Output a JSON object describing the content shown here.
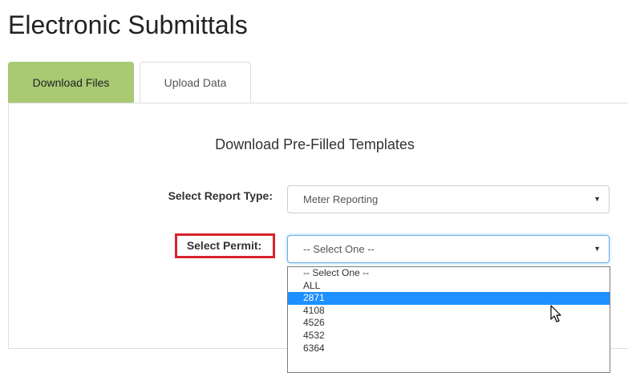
{
  "page": {
    "title": "Electronic Submittals"
  },
  "tabs": [
    {
      "label": "Download Files",
      "active": true
    },
    {
      "label": "Upload Data",
      "active": false
    }
  ],
  "section": {
    "heading": "Download Pre-Filled Templates"
  },
  "form": {
    "report_type": {
      "label": "Select Report Type:",
      "value": "Meter Reporting"
    },
    "permit": {
      "label": "Select Permit:",
      "value": "-- Select One --",
      "options": [
        "-- Select One --",
        "ALL",
        "2871",
        "4108",
        "4526",
        "4532",
        "6364"
      ],
      "highlighted": "2871"
    }
  },
  "icons": {
    "select_arrow": "▼",
    "cursor": "mouse-pointer"
  },
  "colors": {
    "active_tab": "#a9c972",
    "highlight_option": "#1e90ff",
    "callout_border": "#d9232d"
  }
}
